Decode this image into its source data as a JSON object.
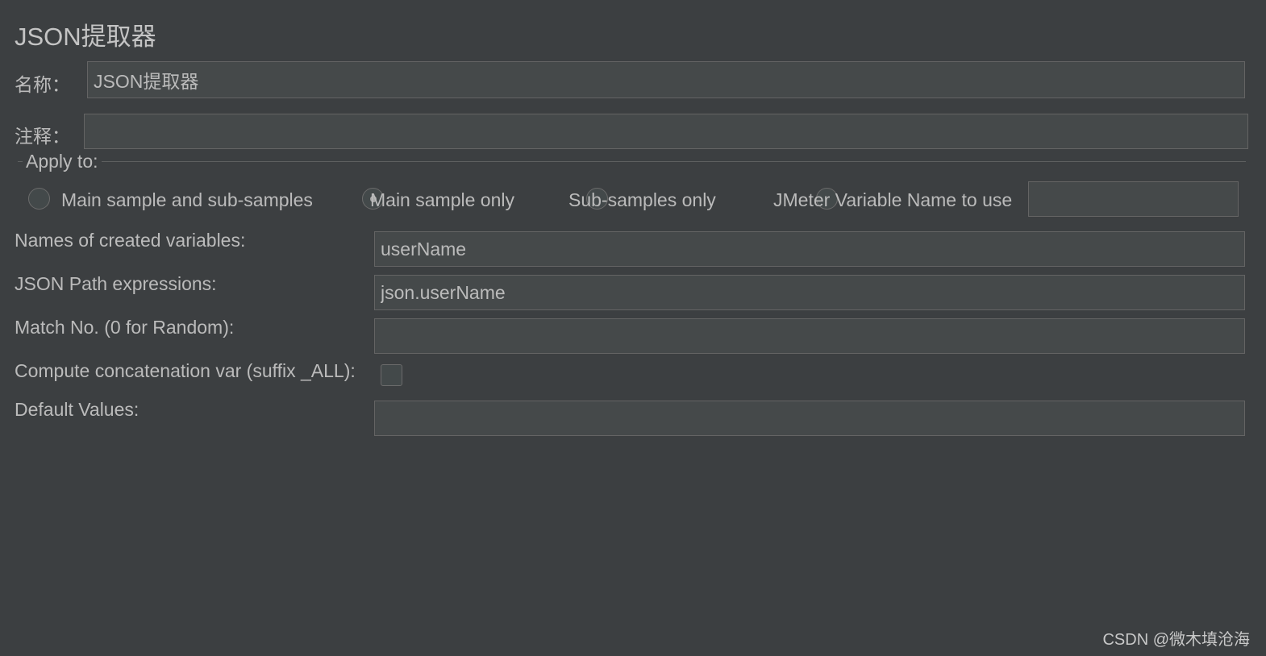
{
  "panel": {
    "title": "JSON提取器",
    "name_label": "名称：",
    "name_value": "JSON提取器",
    "comment_label": "注释：",
    "comment_value": ""
  },
  "apply_to": {
    "legend": "Apply to:",
    "options": [
      {
        "label": "Main sample and sub-samples",
        "selected": false
      },
      {
        "label": "Main sample only",
        "selected": true
      },
      {
        "label": "Sub-samples only",
        "selected": false
      },
      {
        "label": "JMeter Variable Name to use",
        "selected": false
      }
    ],
    "variable_name_value": ""
  },
  "form": {
    "names_label": "Names of created variables:",
    "names_value": "userName",
    "paths_label": "JSON Path expressions:",
    "paths_value": "json.userName",
    "match_label": "Match No. (0 for Random):",
    "match_value": "",
    "concat_label": "Compute concatenation var (suffix _ALL):",
    "concat_checked": false,
    "default_label": "Default Values:",
    "default_value": ""
  },
  "watermark": "CSDN @微木填沧海",
  "colors": {
    "background": "#3c3f41",
    "field_background": "#45494a",
    "text": "#bbbbbb"
  }
}
